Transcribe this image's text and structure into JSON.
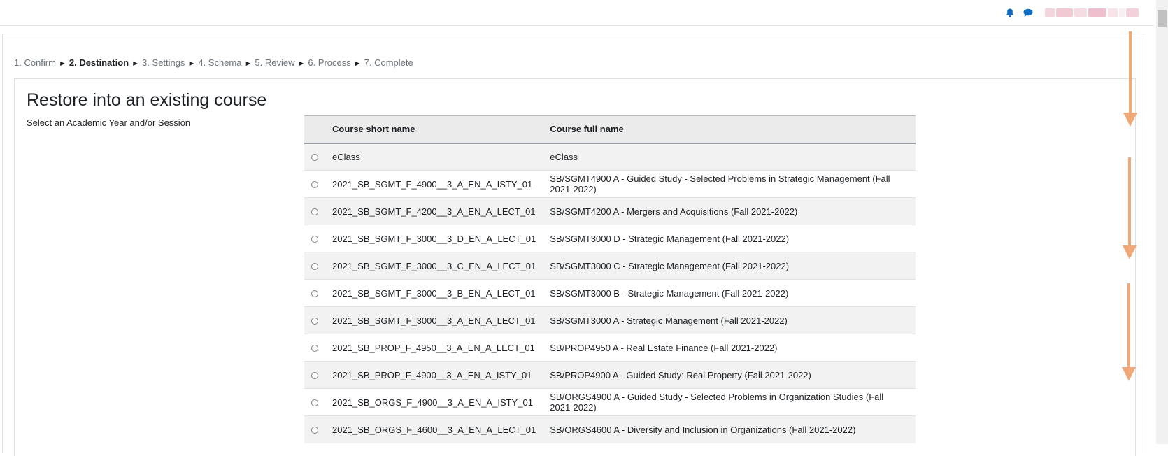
{
  "header": {
    "icons": [
      "bell-icon",
      "chat-bubble-icon"
    ],
    "user_name_blurred": true
  },
  "steps": [
    {
      "label": "1. Confirm",
      "current": false
    },
    {
      "label": "2. Destination",
      "current": true
    },
    {
      "label": "3. Settings",
      "current": false
    },
    {
      "label": "4. Schema",
      "current": false
    },
    {
      "label": "5. Review",
      "current": false
    },
    {
      "label": "6. Process",
      "current": false
    },
    {
      "label": "7. Complete",
      "current": false
    }
  ],
  "step_separator": "►",
  "section": {
    "title": "Restore into an existing course",
    "hint": "Select an Academic Year and/or Session"
  },
  "table": {
    "headers": {
      "short_name": "Course short name",
      "full_name": "Course full name"
    },
    "rows": [
      {
        "short": "eClass",
        "full": "eClass"
      },
      {
        "short": "2021_SB_SGMT_F_4900__3_A_EN_A_ISTY_01",
        "full": "SB/SGMT4900 A - Guided Study - Selected Problems in Strategic Management (Fall 2021-2022)"
      },
      {
        "short": "2021_SB_SGMT_F_4200__3_A_EN_A_LECT_01",
        "full": "SB/SGMT4200 A - Mergers and Acquisitions (Fall 2021-2022)"
      },
      {
        "short": "2021_SB_SGMT_F_3000__3_D_EN_A_LECT_01",
        "full": "SB/SGMT3000 D - Strategic Management (Fall 2021-2022)"
      },
      {
        "short": "2021_SB_SGMT_F_3000__3_C_EN_A_LECT_01",
        "full": "SB/SGMT3000 C - Strategic Management (Fall 2021-2022)"
      },
      {
        "short": "2021_SB_SGMT_F_3000__3_B_EN_A_LECT_01",
        "full": "SB/SGMT3000 B - Strategic Management (Fall 2021-2022)"
      },
      {
        "short": "2021_SB_SGMT_F_3000__3_A_EN_A_LECT_01",
        "full": "SB/SGMT3000 A - Strategic Management (Fall 2021-2022)"
      },
      {
        "short": "2021_SB_PROP_F_4950__3_A_EN_A_LECT_01",
        "full": "SB/PROP4950 A - Real Estate Finance (Fall 2021-2022)"
      },
      {
        "short": "2021_SB_PROP_F_4900__3_A_EN_A_ISTY_01",
        "full": "SB/PROP4900 A - Guided Study: Real Property (Fall 2021-2022)"
      },
      {
        "short": "2021_SB_ORGS_F_4900__3_A_EN_A_ISTY_01",
        "full": "SB/ORGS4900 A - Guided Study - Selected Problems in Organization Studies (Fall 2021-2022)"
      },
      {
        "short": "2021_SB_ORGS_F_4600__3_A_EN_A_LECT_01",
        "full": "SB/ORGS4600 A - Diversity and Inclusion in Organizations (Fall 2021-2022)"
      }
    ]
  },
  "annotations": {
    "arrow_count": 3,
    "arrow_color": "#f0a878",
    "direction": "down"
  },
  "colors": {
    "accent": "#0f6cbf",
    "text": "#1d2125",
    "muted": "#6a737b"
  }
}
